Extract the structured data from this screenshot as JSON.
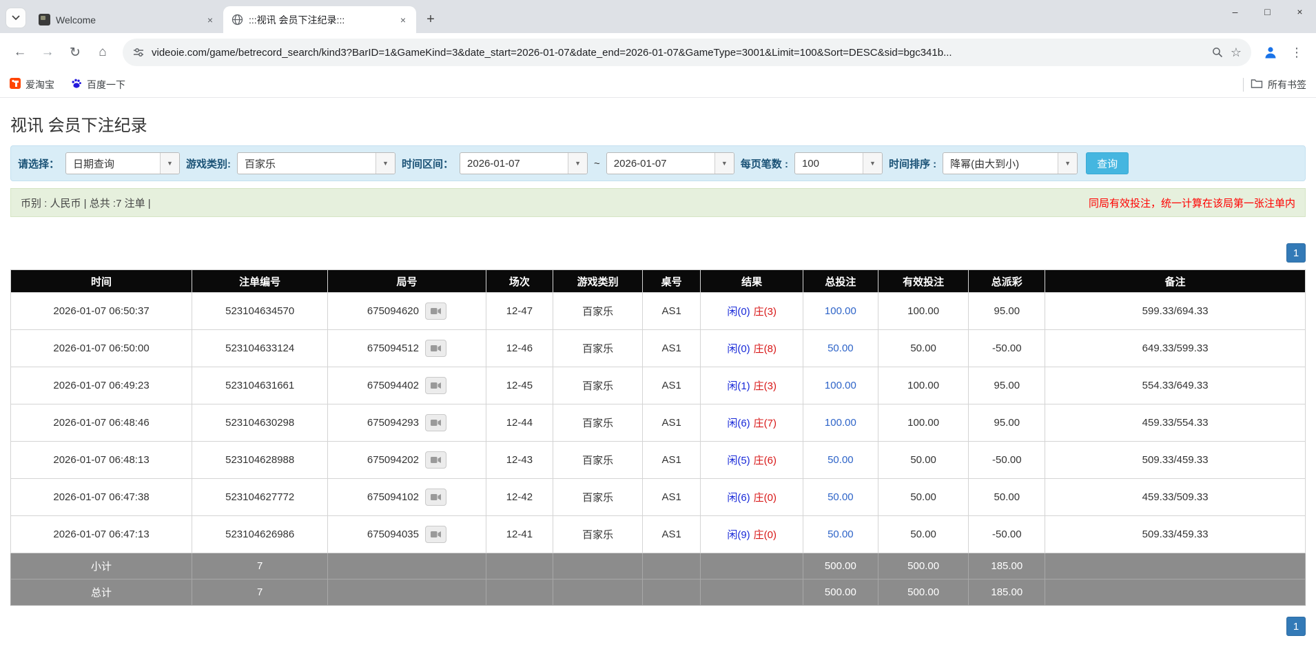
{
  "browser": {
    "tabs": [
      {
        "title": "Welcome"
      },
      {
        "title": ":::视讯 会员下注纪录:::"
      }
    ],
    "url": "videoie.com/game/betrecord_search/kind3?BarID=1&GameKind=3&date_start=2026-01-07&date_end=2026-01-07&GameType=3001&Limit=100&Sort=DESC&sid=bgc341b...",
    "bookmarks": [
      {
        "label": "爱淘宝"
      },
      {
        "label": "百度一下"
      }
    ],
    "all_bookmarks_label": "所有书签"
  },
  "icons": {
    "back": "←",
    "forward": "→",
    "refresh": "↻",
    "home": "⌂",
    "star": "☆",
    "menu": "⋮",
    "minimize": "–",
    "maximize": "□",
    "close": "×",
    "tab_close": "×",
    "new_tab": "+",
    "combo_arrow": "▼"
  },
  "page": {
    "title": "视讯 会员下注纪录",
    "filters": {
      "select_label": "请选择：",
      "select_value": "日期查询",
      "game_type_label": "游戏类别:",
      "game_type_value": "百家乐",
      "date_range_label": "时间区间：",
      "date_start": "2026-01-07",
      "range_separator": "~",
      "date_end": "2026-01-07",
      "page_size_label": "每页笔数 :",
      "page_size_value": "100",
      "sort_label": "时间排序 :",
      "sort_value": "降幂(由大到小)",
      "search_button": "查询"
    },
    "summary": "币别 : 人民币 | 总共 :7 注单 |",
    "notice": "同局有效投注，统一计算在该局第一张注单内",
    "pagination": "1"
  },
  "table": {
    "headers": [
      "时间",
      "注单编号",
      "局号",
      "场次",
      "游戏类别",
      "桌号",
      "结果",
      "总投注",
      "有效投注",
      "总派彩",
      "备注"
    ],
    "rows": [
      {
        "time": "2026-01-07 06:50:37",
        "bet_no": "523104634570",
        "round_no": "675094620",
        "session": "12-47",
        "game": "百家乐",
        "table_no": "AS1",
        "result_player": "闲(0)",
        "result_banker": "庄(3)",
        "total_bet": "100.00",
        "valid_bet": "100.00",
        "payout": "95.00",
        "remark": "599.33/694.33"
      },
      {
        "time": "2026-01-07 06:50:00",
        "bet_no": "523104633124",
        "round_no": "675094512",
        "session": "12-46",
        "game": "百家乐",
        "table_no": "AS1",
        "result_player": "闲(0)",
        "result_banker": "庄(8)",
        "total_bet": "50.00",
        "valid_bet": "50.00",
        "payout": "-50.00",
        "remark": "649.33/599.33"
      },
      {
        "time": "2026-01-07 06:49:23",
        "bet_no": "523104631661",
        "round_no": "675094402",
        "session": "12-45",
        "game": "百家乐",
        "table_no": "AS1",
        "result_player": "闲(1)",
        "result_banker": "庄(3)",
        "total_bet": "100.00",
        "valid_bet": "100.00",
        "payout": "95.00",
        "remark": "554.33/649.33"
      },
      {
        "time": "2026-01-07 06:48:46",
        "bet_no": "523104630298",
        "round_no": "675094293",
        "session": "12-44",
        "game": "百家乐",
        "table_no": "AS1",
        "result_player": "闲(6)",
        "result_banker": "庄(7)",
        "total_bet": "100.00",
        "valid_bet": "100.00",
        "payout": "95.00",
        "remark": "459.33/554.33"
      },
      {
        "time": "2026-01-07 06:48:13",
        "bet_no": "523104628988",
        "round_no": "675094202",
        "session": "12-43",
        "game": "百家乐",
        "table_no": "AS1",
        "result_player": "闲(5)",
        "result_banker": "庄(6)",
        "total_bet": "50.00",
        "valid_bet": "50.00",
        "payout": "-50.00",
        "remark": "509.33/459.33"
      },
      {
        "time": "2026-01-07 06:47:38",
        "bet_no": "523104627772",
        "round_no": "675094102",
        "session": "12-42",
        "game": "百家乐",
        "table_no": "AS1",
        "result_player": "闲(6)",
        "result_banker": "庄(0)",
        "total_bet": "50.00",
        "valid_bet": "50.00",
        "payout": "50.00",
        "remark": "459.33/509.33"
      },
      {
        "time": "2026-01-07 06:47:13",
        "bet_no": "523104626986",
        "round_no": "675094035",
        "session": "12-41",
        "game": "百家乐",
        "table_no": "AS1",
        "result_player": "闲(9)",
        "result_banker": "庄(0)",
        "total_bet": "50.00",
        "valid_bet": "50.00",
        "payout": "-50.00",
        "remark": "509.33/459.33"
      }
    ],
    "footer": [
      {
        "label": "小计",
        "count": "7",
        "total_bet": "500.00",
        "valid_bet": "500.00",
        "payout": "185.00"
      },
      {
        "label": "总计",
        "count": "7",
        "total_bet": "500.00",
        "valid_bet": "500.00",
        "payout": "185.00"
      }
    ]
  },
  "colors": {
    "player_blue": "#1728d8",
    "banker_red": "#d81717",
    "negative_red": "#e80000",
    "link_blue": "#2e64c8",
    "pagination_blue": "#337ab7",
    "search_button_blue": "#45b6e0",
    "filter_bg": "#d9edf7",
    "info_bg": "#e6f0dd",
    "header_black": "#0a0a0a",
    "footer_gray": "#8c8c8c"
  }
}
